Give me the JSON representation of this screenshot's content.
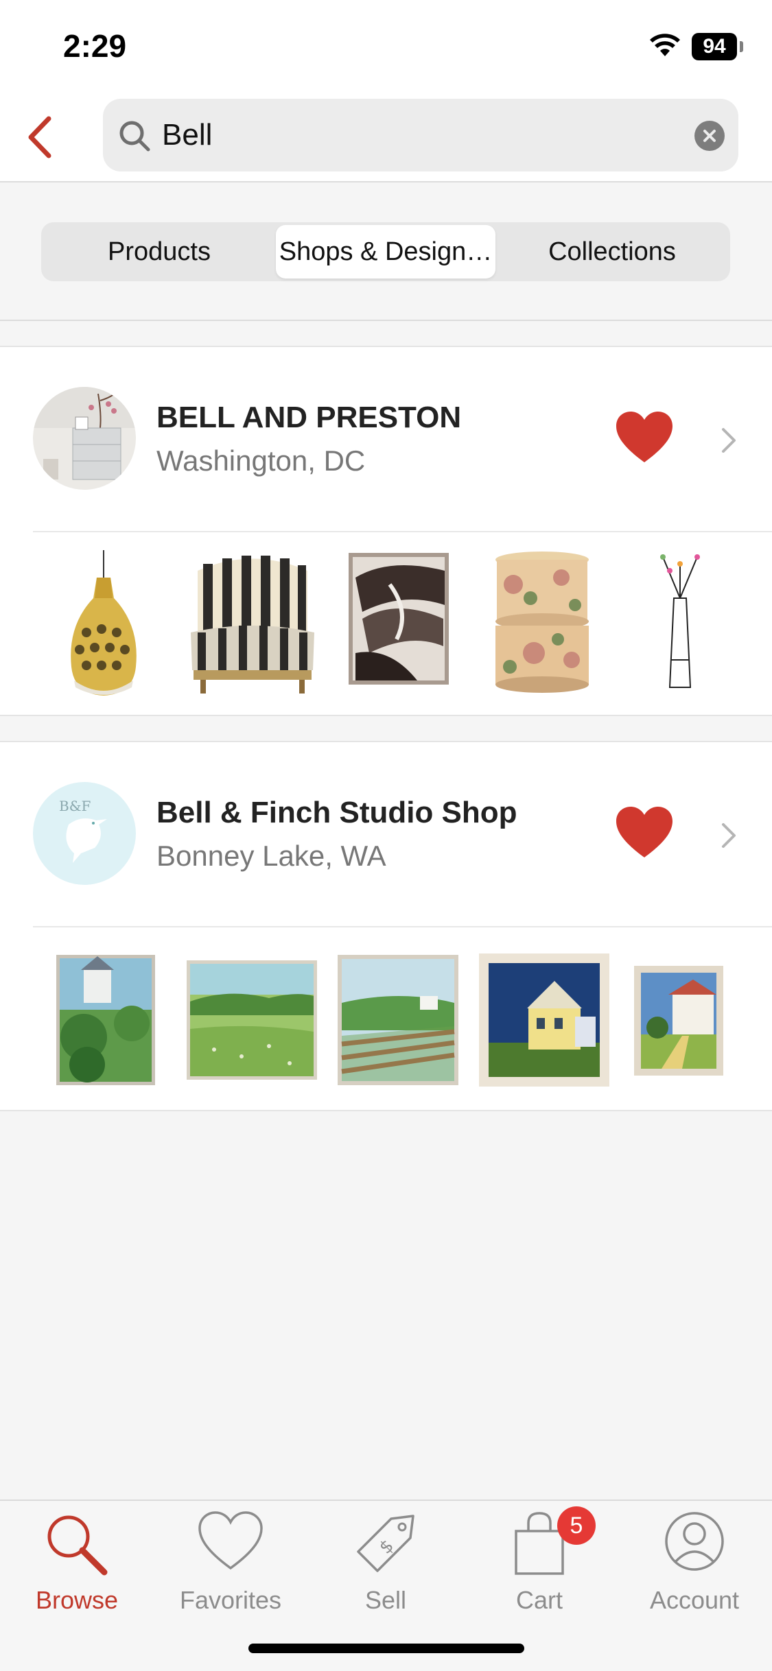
{
  "status_bar": {
    "time": "2:29",
    "battery": "94"
  },
  "search": {
    "value": "Bell"
  },
  "segments": {
    "tabs": [
      "Products",
      "Shops & Design…",
      "Collections"
    ],
    "active": 1
  },
  "shops": [
    {
      "name": "BELL AND PRESTON",
      "location": "Washington, DC",
      "favorited": true,
      "thumbnails": [
        "pendant-lamp",
        "striped-armchair",
        "abstract-print",
        "floral-hatboxes",
        "coat-rack"
      ]
    },
    {
      "name": "Bell & Finch Studio Shop",
      "location": "Bonney Lake, WA",
      "logo_text": "B&F",
      "favorited": true,
      "thumbnails": [
        "house-garden-painting",
        "meadow-painting",
        "farmland-painting",
        "yellow-house-painting",
        "white-house-painting"
      ]
    }
  ],
  "tab_bar": {
    "items": [
      {
        "label": "Browse",
        "icon": "search-icon",
        "active": true
      },
      {
        "label": "Favorites",
        "icon": "heart-icon",
        "active": false
      },
      {
        "label": "Sell",
        "icon": "price-tag-icon",
        "active": false
      },
      {
        "label": "Cart",
        "icon": "shopping-bag-icon",
        "active": false,
        "badge": "5"
      },
      {
        "label": "Account",
        "icon": "person-icon",
        "active": false
      }
    ]
  },
  "colors": {
    "accent": "#c0392b",
    "heart": "#d0382e",
    "badge": "#e53935"
  }
}
